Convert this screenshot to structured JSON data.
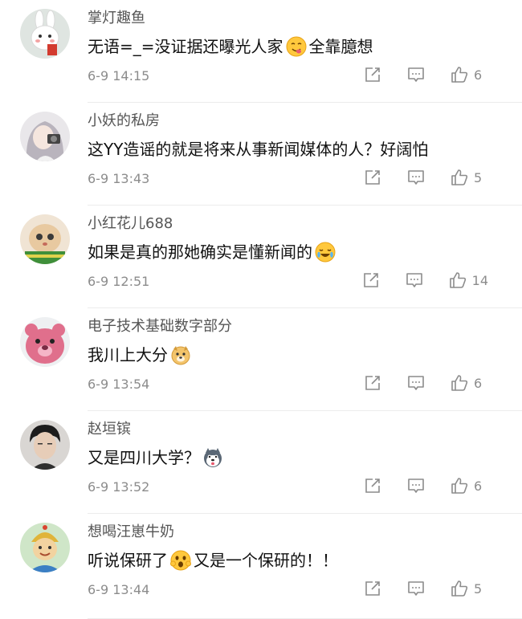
{
  "comments": [
    {
      "name": "掌灯趣鱼",
      "text_before": "无语=_=没证据还曝光人家",
      "emoji": "yum-face-emoji",
      "text_after": "全靠臆想",
      "time": "6-9 14:15",
      "likes": "6"
    },
    {
      "name": "小妖的私房",
      "text_before": "这YY造谣的就是将来从事新闻媒体的人？好阔怕",
      "emoji": "",
      "text_after": "",
      "time": "6-9 13:43",
      "likes": "5"
    },
    {
      "name": "小红花儿688",
      "text_before": "如果是真的那她确实是懂新闻的",
      "emoji": "crying-laughing-emoji",
      "text_after": "",
      "time": "6-9 12:51",
      "likes": "14"
    },
    {
      "name": "电子技术基础数字部分",
      "text_before": "我川上大分",
      "emoji": "doge-emoji",
      "text_after": "",
      "time": "6-9 13:54",
      "likes": "6"
    },
    {
      "name": "赵垣镔",
      "text_before": "又是四川大学？",
      "emoji": "husky-emoji",
      "text_after": "",
      "time": "6-9 13:52",
      "likes": "6"
    },
    {
      "name": "想喝汪崽牛奶",
      "text_before": "听说保研了",
      "emoji": "shocked-face-emoji",
      "text_after": "又是一个保研的！！",
      "time": "6-9 13:44",
      "likes": "5"
    }
  ],
  "icons": {
    "share": "share-icon",
    "comment": "comment-icon",
    "like": "thumbs-up-icon"
  }
}
